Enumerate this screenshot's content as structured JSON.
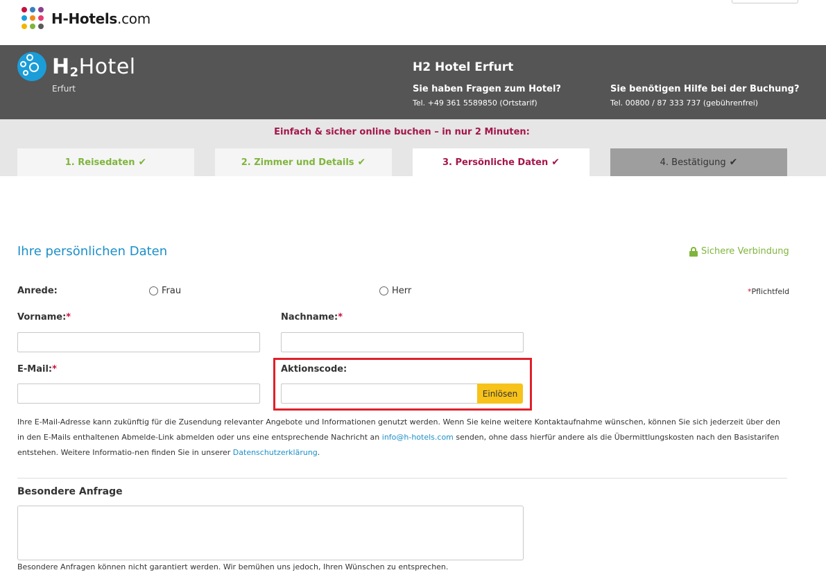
{
  "site": {
    "name": "H-Hotels",
    "domain": ".com"
  },
  "hotel": {
    "brand_h": "H",
    "brand_2": "2",
    "brand_hotel": "Hotel",
    "city": "Erfurt",
    "title": "H2 Hotel Erfurt",
    "q_hotel": "Sie haben Fragen zum Hotel?",
    "tel_hotel": "Tel. +49 361 5589850 (Ortstarif)",
    "q_booking": "Sie benötigen Hilfe bei der Buchung?",
    "tel_booking": "Tel. 00800 / 87 333 737 (gebührenfrei)"
  },
  "steps": {
    "slogan": "Einfach & sicher online buchen – in nur 2 Minuten:",
    "items": [
      {
        "label": "1. Reisedaten",
        "state": "done"
      },
      {
        "label": "2. Zimmer und Details",
        "state": "done"
      },
      {
        "label": "3. Persönliche Daten",
        "state": "active"
      },
      {
        "label": "4. Bestätigung",
        "state": "next"
      }
    ]
  },
  "form": {
    "title": "Ihre persönlichen Daten",
    "secure": "Sichere Verbindung",
    "anrede_label": "Anrede:",
    "anrede_options": [
      "Frau",
      "Herr"
    ],
    "pflicht_star": "*",
    "pflicht": "Pflichtfeld",
    "vorname_label": "Vorname:",
    "nachname_label": "Nachname:",
    "email_label": "E-Mail:",
    "aktionscode_label": "Aktionscode:",
    "required_mark": "*",
    "vorname_value": "",
    "nachname_value": "",
    "email_value": "",
    "aktionscode_value": "",
    "einloesen": "Einlösen",
    "privacy_1": "Ihre E-Mail-Adresse kann zukünftig für die Zusendung relevanter Angebote und Informationen genutzt werden. Wenn Sie keine weitere Kontaktaufnahme wünschen, können Sie sich jederzeit über den in den E-Mails enthaltenen Abmelde-Link abmelden oder uns eine entsprechende Nachricht an ",
    "privacy_email": "info@h-hotels.com",
    "privacy_2": " senden, ohne dass hierfür andere als die Übermittlungskosten nach den Basistarifen entstehen. Weitere Informatio-nen finden Sie in unserer ",
    "privacy_link": "Datenschutzerklärung",
    "privacy_3": ".",
    "anfrage_label": "Besondere Anfrage",
    "anfrage_note": "Besondere Anfragen können nicht garantiert werden. Wir bemühen uns jedoch, Ihren Wünschen zu entsprechen."
  },
  "colors": {
    "accent_blue": "#1b8fc8",
    "accent_green": "#7fb53c",
    "accent_red": "#a4164a",
    "button_yellow": "#f7c21a",
    "highlight_box": "#e0202a"
  }
}
